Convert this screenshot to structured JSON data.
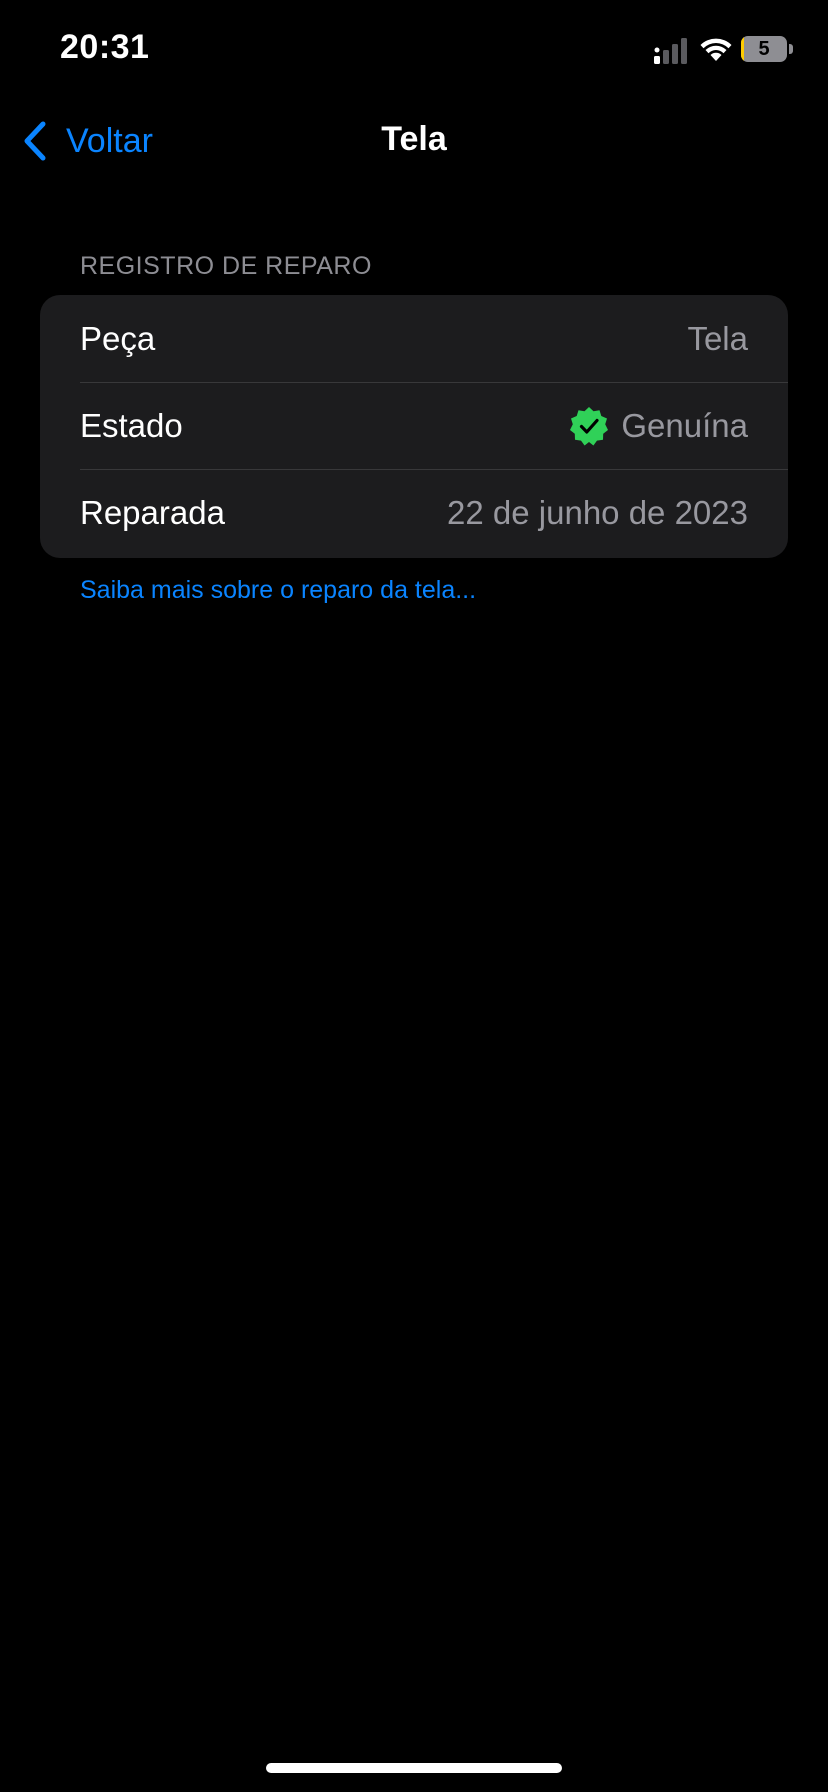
{
  "status_bar": {
    "time": "20:31",
    "battery_level": "5",
    "battery_fraction": 0.05,
    "signal_icon": "cellular-signal-icon",
    "wifi_icon": "wifi-icon",
    "battery_icon": "battery-icon"
  },
  "nav": {
    "back_label": "Voltar",
    "back_icon": "chevron-left-icon",
    "title": "Tela"
  },
  "section": {
    "header": "REGISTRO DE REPARO",
    "rows": [
      {
        "label": "Peça",
        "value": "Tela"
      },
      {
        "label": "Estado",
        "value": "Genuína",
        "icon": "verified-badge-icon"
      },
      {
        "label": "Reparada",
        "value": "22 de junho de 2023"
      }
    ],
    "footer_link": "Saiba mais sobre o reparo da tela..."
  },
  "colors": {
    "accent": "#0a84ff",
    "background": "#000000",
    "card": "#1c1c1e",
    "secondary_text": "#98989f",
    "verified_green": "#30d158",
    "battery_low": "#ffcc00"
  }
}
